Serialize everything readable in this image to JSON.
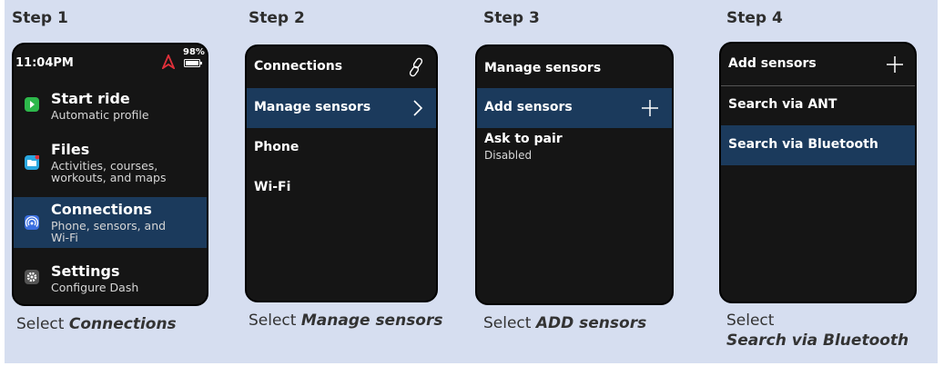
{
  "steps": [
    {
      "title": "Step 1",
      "caption_prefix": "Select ",
      "caption_bold": "Connections",
      "screen": {
        "time": "11:04PM",
        "battery": "98%",
        "menu": [
          {
            "title": "Start ride",
            "sub1": "Automatic profile",
            "sub2": "",
            "icon": "play-icon",
            "color": "#2db84b"
          },
          {
            "title": "Files",
            "sub1": "Activities, courses,",
            "sub2": "workouts, and maps",
            "icon": "folder-icon",
            "color": "#2aa7e0"
          },
          {
            "title": "Connections",
            "sub1": "Phone, sensors, and",
            "sub2": "Wi-Fi",
            "icon": "signal-icon",
            "color": "#3b6fe0"
          },
          {
            "title": "Settings",
            "sub1": "Configure Dash",
            "sub2": "",
            "icon": "gear-icon",
            "color": "#555555"
          }
        ]
      }
    },
    {
      "title": "Step 2",
      "caption_prefix": "Select ",
      "caption_bold": "Manage sensors",
      "screen": {
        "header": "Connections",
        "rows": [
          "Manage sensors",
          "Phone",
          "Wi-Fi"
        ]
      }
    },
    {
      "title": "Step 3",
      "caption_prefix": "Select ",
      "caption_bold": "ADD sensors",
      "screen": {
        "header": "Manage sensors",
        "rows": [
          "Add sensors"
        ],
        "pair_label": "Ask to pair",
        "pair_value": "Disabled"
      }
    },
    {
      "title": "Step 4",
      "caption_prefix": "Select",
      "caption_bold": "Search via Bluetooth",
      "screen": {
        "header": "Add sensors",
        "rows": [
          "Search via ANT",
          "Search via Bluetooth"
        ]
      }
    }
  ],
  "colors": {
    "background": "#d6def0",
    "selected_row": "#1b3a5c",
    "device": "#151515",
    "alert_icon": "#e0303a"
  }
}
